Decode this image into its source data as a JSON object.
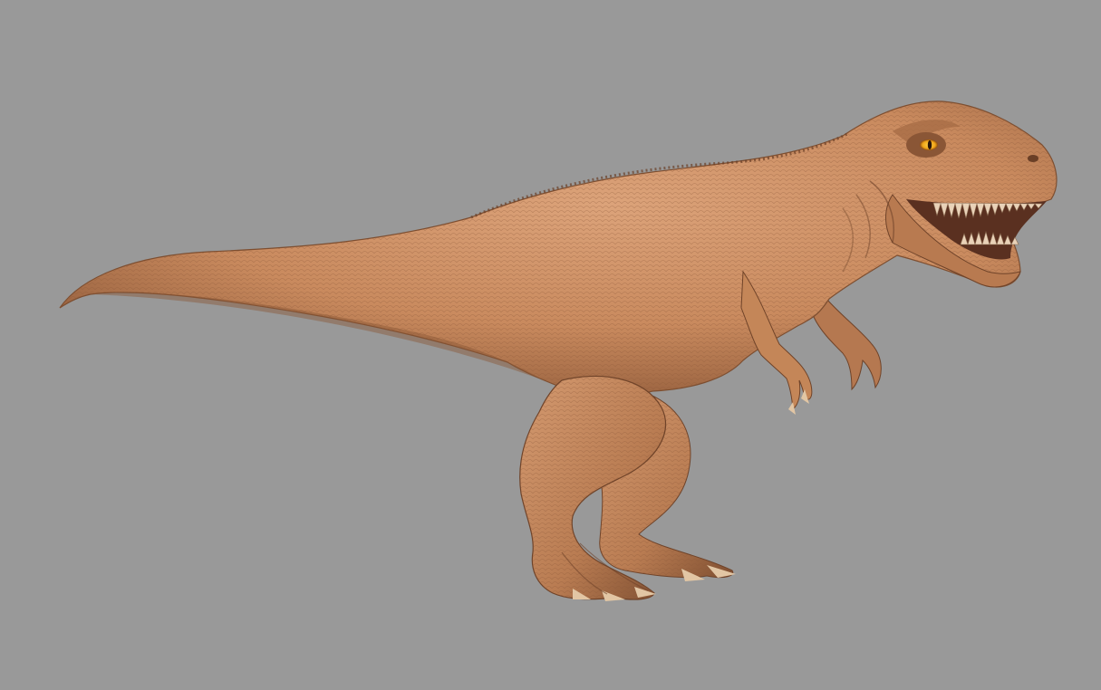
{
  "scene": {
    "subject": "t-rex-sculpt",
    "background_color": "#999999",
    "skin_base_color": "#c98a5e",
    "skin_shadow_color": "#7d4e30",
    "skin_highlight_color": "#dca37a",
    "eye_color": "#f0a418",
    "teeth_color": "#e9d2b8",
    "mouth_interior_color": "#5a3020"
  }
}
